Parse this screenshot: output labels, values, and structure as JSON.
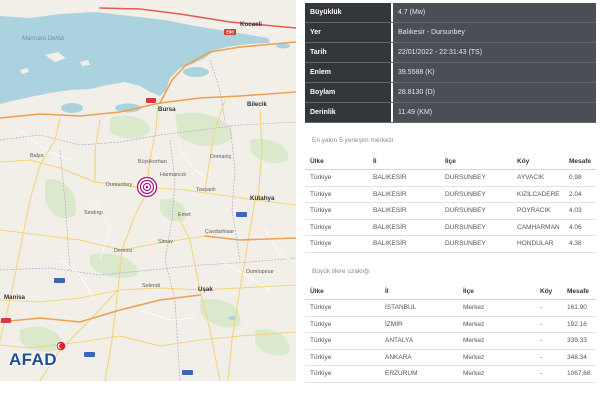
{
  "map": {
    "labels": [
      "Marmara Denizi",
      "Kocaeli",
      "Bursa",
      "Bilecik",
      "Balya",
      "Büyükorhan",
      "Harmancık",
      "Dursunbey",
      "Domaniç",
      "Tavşanlı",
      "Kütahya",
      "Sındırgı",
      "Emet",
      "Simav",
      "Demirci",
      "Çavdarhisar",
      "Selendi",
      "Uşak",
      "Dumlupınar",
      "Manisa"
    ],
    "road_shield": "E80",
    "epicenter_icon": "epicenter-target-icon",
    "logo": "AFAD",
    "colors": {
      "water": "#aad3df",
      "land": "#f2efe9",
      "forest": "#d5e7c6",
      "road": "#f3d47a",
      "highway": "#ee9f52",
      "boundary": "#b7a5cc",
      "epicenter": "#a0157a",
      "logo": "#1c4d9b",
      "logo_emblem": "#d8262e"
    }
  },
  "details": {
    "rows": [
      {
        "label": "Büyüklük",
        "value": "4.7 (Mw)"
      },
      {
        "label": "Yer",
        "value": "Balıkesir - Dursunbey"
      },
      {
        "label": "Tarih",
        "value": "22/01/2022 - 22:31:43 (TS)"
      },
      {
        "label": "Enlem",
        "value": "39.5588 (K)"
      },
      {
        "label": "Boylam",
        "value": "28.8130 (D)"
      },
      {
        "label": "Derinlik",
        "value": "11.49 (KM)"
      }
    ],
    "colors": {
      "label_bg": "#33373c",
      "value_bg": "#4a4f55"
    }
  },
  "nearest": {
    "title": "En yakın 5 yerleşim merkezi",
    "columns": [
      "Ülke",
      "İl",
      "İlçe",
      "Köy",
      "Mesafe"
    ],
    "rows": [
      [
        "Türkiye",
        "BALIKESİR",
        "DURSUNBEY",
        "AYVACIK",
        "0.98"
      ],
      [
        "Türkiye",
        "BALIKESİR",
        "DURSUNBEY",
        "KIZILCADERE",
        "2.04"
      ],
      [
        "Türkiye",
        "BALIKESİR",
        "DURSUNBEY",
        "POYRACIK",
        "4.03"
      ],
      [
        "Türkiye",
        "BALIKESİR",
        "DURSUNBEY",
        "CAMHARMAN",
        "4.06"
      ],
      [
        "Türkiye",
        "BALIKESİR",
        "DURSUNBEY",
        "HONDULAR",
        "4.38"
      ]
    ]
  },
  "cities": {
    "title": "Büyük illere uzaklığı",
    "columns": [
      "Ülke",
      "İl",
      "İlçe",
      "Köy",
      "Mesafe"
    ],
    "rows": [
      [
        "Türkiye",
        "İSTANBUL",
        "Merkez",
        "-",
        "161.90"
      ],
      [
        "Türkiye",
        "İZMİR",
        "Merkez",
        "-",
        "192.16"
      ],
      [
        "Türkiye",
        "ANTALYA",
        "Merkez",
        "-",
        "339.33"
      ],
      [
        "Türkiye",
        "ANKARA",
        "Merkez",
        "-",
        "348.34"
      ],
      [
        "Türkiye",
        "ERZURUM",
        "Merkez",
        "-",
        "1067.68"
      ]
    ]
  }
}
